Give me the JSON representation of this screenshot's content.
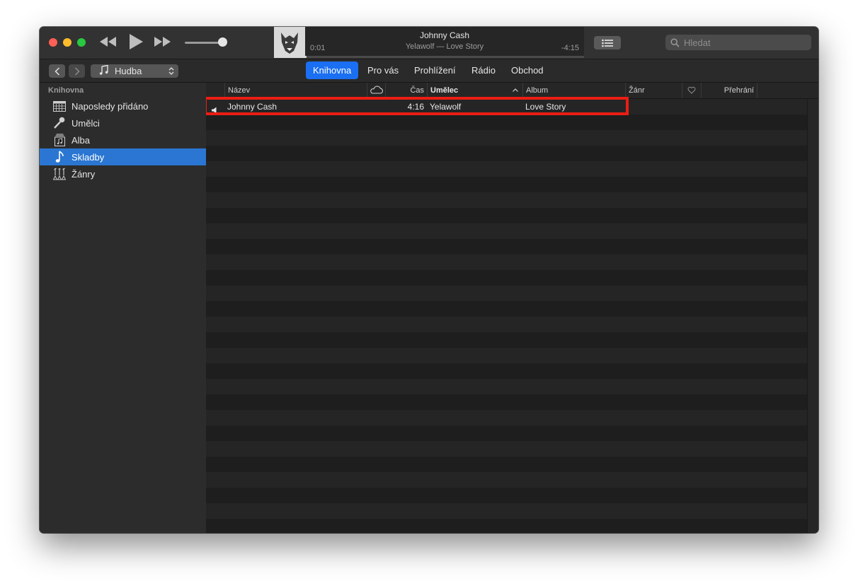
{
  "player": {
    "track_title": "Johnny Cash",
    "track_subtitle": "Yelawolf — Love Story",
    "elapsed": "0:01",
    "remaining": "-4:15",
    "progress": 0.004,
    "volume": 0.85
  },
  "search": {
    "placeholder": "Hledat"
  },
  "nav": {
    "media_kind": "Hudba",
    "tabs": [
      {
        "label": "Knihovna",
        "active": true
      },
      {
        "label": "Pro vás",
        "active": false
      },
      {
        "label": "Prohlížení",
        "active": false
      },
      {
        "label": "Rádio",
        "active": false
      },
      {
        "label": "Obchod",
        "active": false
      }
    ]
  },
  "sidebar": {
    "heading": "Knihovna",
    "items": [
      {
        "label": "Naposledy přidáno",
        "icon": "grid-icon"
      },
      {
        "label": "Umělci",
        "icon": "microphone-icon"
      },
      {
        "label": "Alba",
        "icon": "album-icon"
      },
      {
        "label": "Skladby",
        "icon": "music-note-icon",
        "selected": true
      },
      {
        "label": "Žánry",
        "icon": "genres-icon"
      }
    ]
  },
  "table": {
    "columns": {
      "name": "Název",
      "time": "Čas",
      "artist": "Umělec",
      "album": "Album",
      "genre": "Žánr",
      "plays": "Přehrání"
    },
    "rows": [
      {
        "name": "Johnny Cash",
        "time": "4:16",
        "artist": "Yelawolf",
        "album": "Love Story",
        "playing": true
      }
    ]
  },
  "colors": {
    "accent": "#1a6ff2",
    "sidebar_selected": "#2a76d2",
    "highlight": "#ea1d14"
  }
}
